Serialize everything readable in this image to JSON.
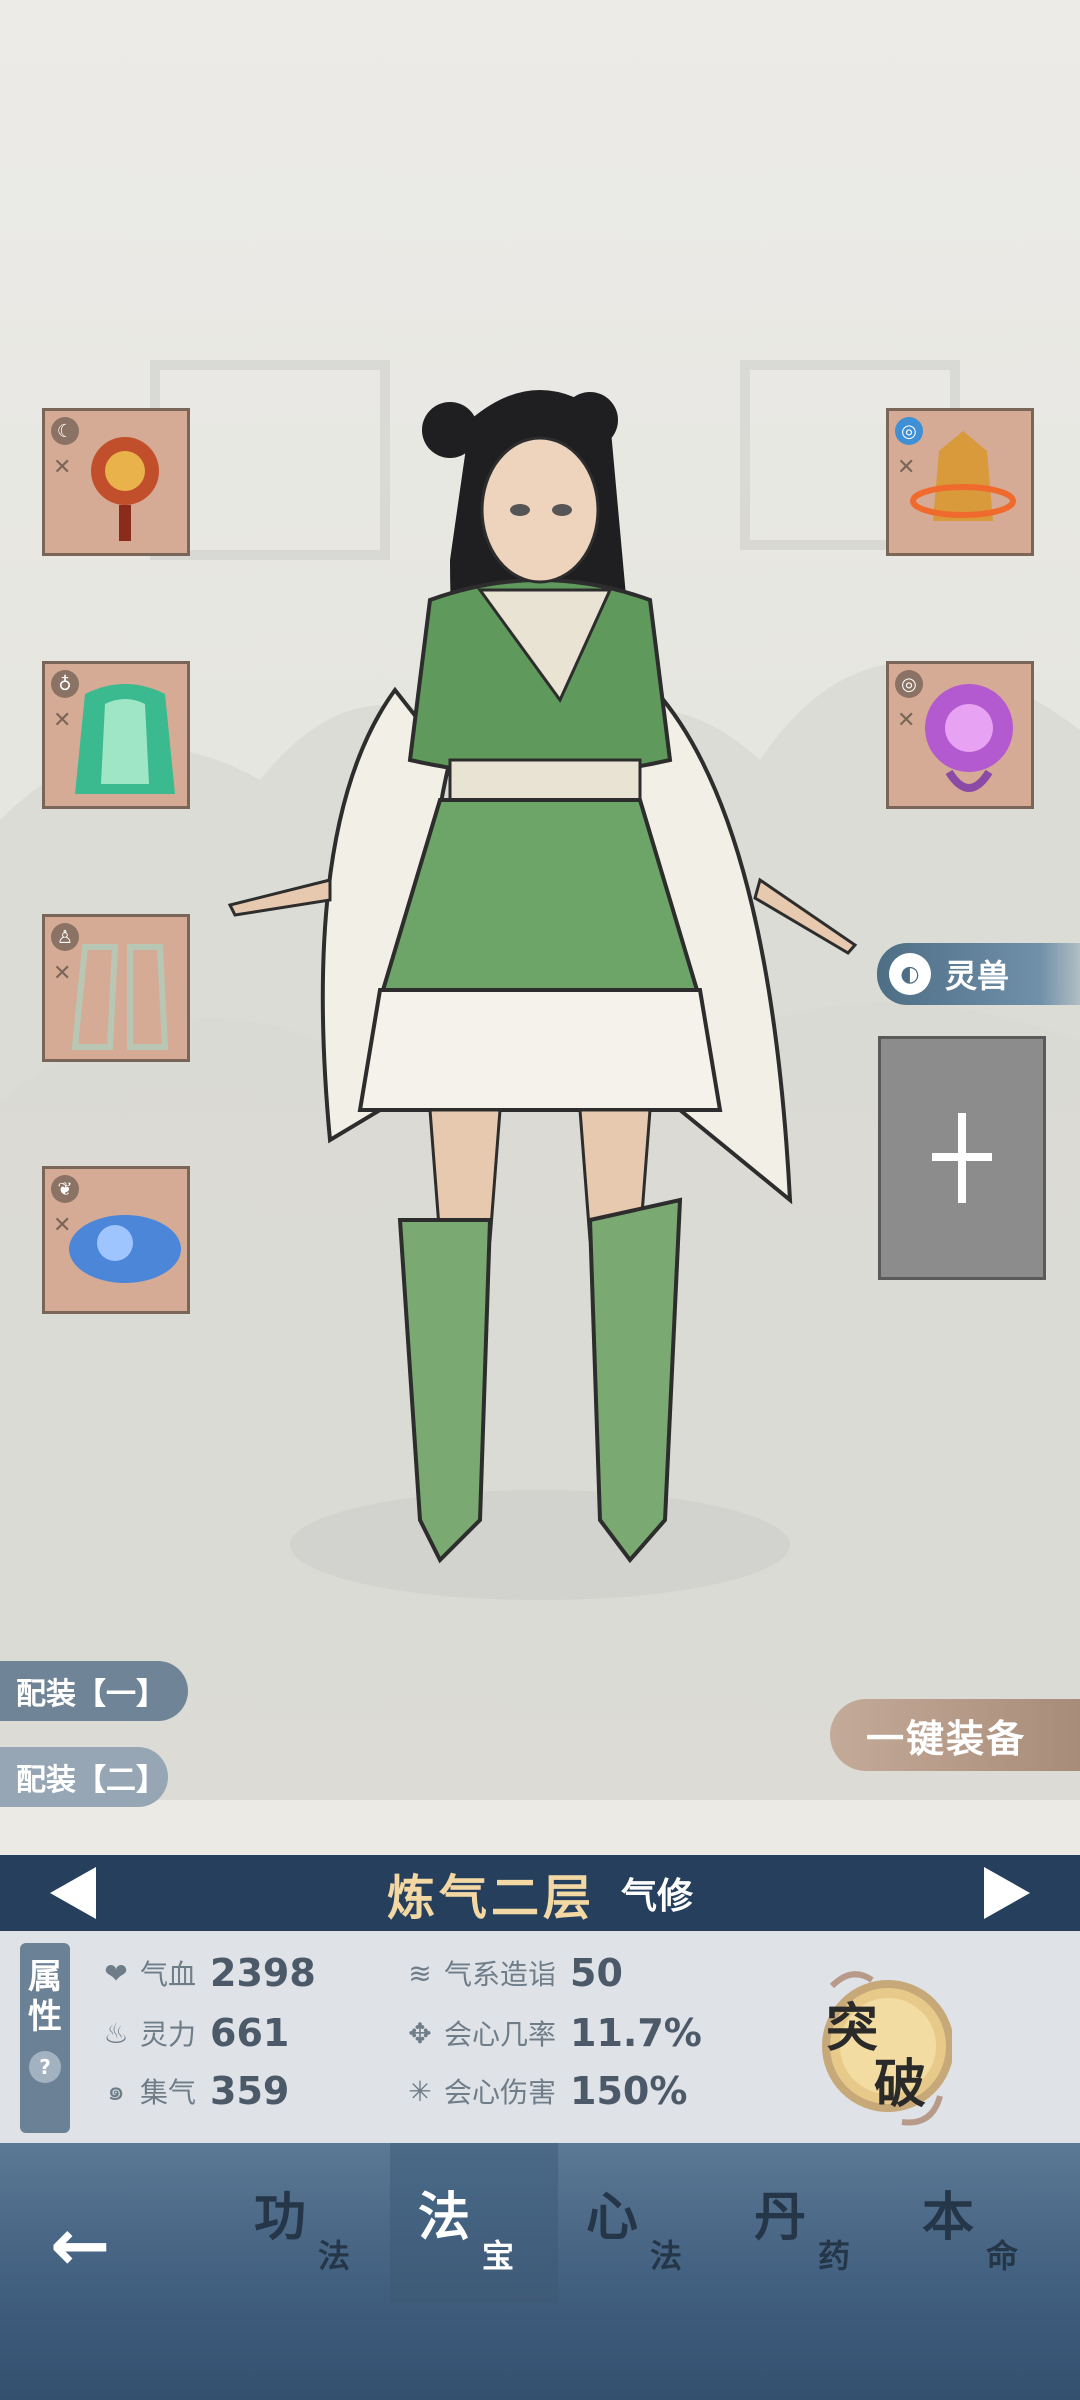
{
  "beast": {
    "label": "灵兽"
  },
  "loadouts": [
    "配装【一】",
    "配装【二】"
  ],
  "equip_all": "一键装备",
  "realm": {
    "name": "炼气二层",
    "type": "气修"
  },
  "stats": {
    "tab_label_1": "属",
    "tab_label_2": "性",
    "help": "?",
    "items": [
      {
        "label": "气血",
        "value": "2398",
        "icon": "heart-icon"
      },
      {
        "label": "灵力",
        "value": "661",
        "icon": "flame-icon"
      },
      {
        "label": "集气",
        "value": "359",
        "icon": "swirl-icon"
      },
      {
        "label": "气系造诣",
        "value": "50",
        "icon": "wind-icon"
      },
      {
        "label": "会心几率",
        "value": "11.7%",
        "icon": "crit-icon"
      },
      {
        "label": "会心伤害",
        "value": "150%",
        "icon": "burst-icon"
      }
    ]
  },
  "breakthrough": {
    "char1": "突",
    "char2": "破"
  },
  "nav": {
    "tabs": [
      {
        "big": "功",
        "small": "法",
        "active": false
      },
      {
        "big": "法",
        "small": "宝",
        "active": true
      },
      {
        "big": "心",
        "small": "法",
        "active": false
      },
      {
        "big": "丹",
        "small": "药",
        "active": false
      },
      {
        "big": "本",
        "small": "命",
        "active": false
      }
    ]
  }
}
